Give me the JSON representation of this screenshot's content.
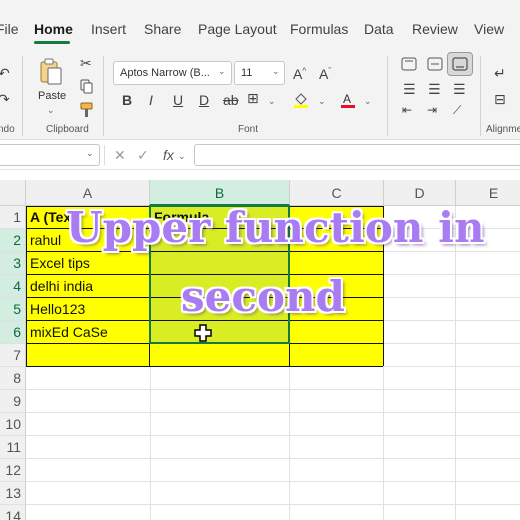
{
  "ribbon_tabs": [
    "File",
    "Home",
    "Insert",
    "Share",
    "Page Layout",
    "Formulas",
    "Data",
    "Review",
    "View"
  ],
  "groups": {
    "undo_label": "ndo",
    "clipboard_label": "Clipboard",
    "font_label": "Font",
    "alignment_label": "Alignme"
  },
  "clipboard": {
    "paste_label": "Paste"
  },
  "font": {
    "family": "Aptos Narrow (B...",
    "size": "11"
  },
  "formula_bar": {
    "fx_label": "fx"
  },
  "columns": [
    "A",
    "B",
    "C",
    "D",
    "E"
  ],
  "rows": [
    "1",
    "2",
    "3",
    "4",
    "5",
    "6",
    "7",
    "8",
    "9",
    "10",
    "11",
    "12",
    "13",
    "14"
  ],
  "cells": {
    "a1": "A (Text)",
    "b1": "Formula",
    "a2": "rahul",
    "a3": "Excel tips",
    "a4": "delhi india",
    "a5": "Hello123",
    "a6": "mixEd CaSe"
  },
  "overlay": {
    "line1": "Upper function in",
    "line2": "second"
  },
  "colors": {
    "fill_yellow": "#ffff00",
    "selection_green": "#107c41",
    "overlay_purple": "#a97cf2"
  }
}
